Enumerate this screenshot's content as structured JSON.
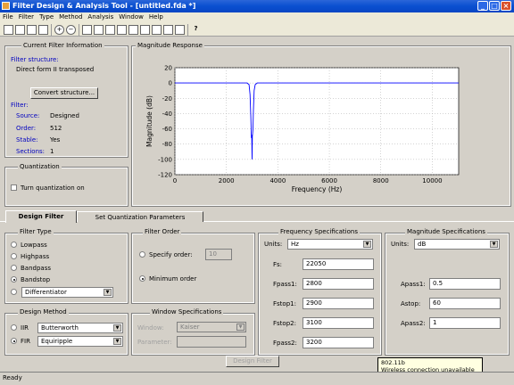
{
  "window": {
    "title": "Filter Design & Analysis Tool - [untitled.fda *]"
  },
  "menu": [
    "File",
    "Filter",
    "Type",
    "Method",
    "Analysis",
    "Window",
    "Help"
  ],
  "current_filter": {
    "title": "Current Filter Information",
    "structure_label": "Filter structure:",
    "structure_value": "Direct form II transposed",
    "convert_button": "Convert structure...",
    "filter_label": "Filter:",
    "source_label": "Source:",
    "source_value": "Designed",
    "order_label": "Order:",
    "order_value": "512",
    "stable_label": "Stable:",
    "stable_value": "Yes",
    "sections_label": "Sections:",
    "sections_value": "1"
  },
  "quantization": {
    "title": "Quantization",
    "checkbox_label": "Turn quantization on"
  },
  "plot_title": "Magnitude Response",
  "chart_data": {
    "type": "line",
    "title": "",
    "xlabel": "Frequency (Hz)",
    "ylabel": "Magnitude (dB)",
    "xlim": [
      0,
      11025
    ],
    "ylim": [
      -120,
      20
    ],
    "xticks": [
      0,
      2000,
      4000,
      6000,
      8000,
      10000
    ],
    "yticks": [
      20,
      0,
      -20,
      -40,
      -60,
      -80,
      -100,
      -120
    ],
    "grid": true,
    "series": [
      {
        "x": [
          0,
          2800,
          2880,
          2920,
          2950,
          2970,
          2985,
          3000,
          3010,
          3020,
          3035,
          3050,
          3080,
          3120,
          3200,
          11025
        ],
        "y": [
          0,
          0,
          -2,
          -15,
          -45,
          -72,
          -68,
          -100,
          -70,
          -66,
          -60,
          -35,
          -10,
          -2,
          0,
          0
        ],
        "color": "#0000ff"
      }
    ]
  },
  "tabs": {
    "design": "Design Filter",
    "quant": "Set Quantization Parameters"
  },
  "filter_type": {
    "title": "Filter Type",
    "lowpass": "Lowpass",
    "highpass": "Highpass",
    "bandpass": "Bandpass",
    "bandstop": "Bandstop",
    "differentiator": "Differentiator"
  },
  "design_method": {
    "title": "Design Method",
    "iir": "IIR",
    "iir_value": "Butterworth",
    "fir": "FIR",
    "fir_value": "Equiripple"
  },
  "filter_order": {
    "title": "Filter Order",
    "specify": "Specify order:",
    "specify_value": "10",
    "minimum": "Minimum order"
  },
  "window_specs": {
    "title": "Window Specifications",
    "window_label": "Window:",
    "window_value": "Kaiser",
    "param_label": "Parameter:"
  },
  "freq_specs": {
    "title": "Frequency Specifications",
    "units_label": "Units:",
    "units_value": "Hz",
    "fs_label": "Fs:",
    "fs": "22050",
    "fpass1_label": "Fpass1:",
    "fpass1": "2800",
    "fstop1_label": "Fstop1:",
    "fstop1": "2900",
    "fstop2_label": "Fstop2:",
    "fstop2": "3100",
    "fpass2_label": "Fpass2:",
    "fpass2": "3200"
  },
  "mag_specs": {
    "title": "Magnitude Specifications",
    "units_label": "Units:",
    "units_value": "dB",
    "apass1_label": "Apass1:",
    "apass1": "0.5",
    "astop_label": "Astop:",
    "astop": "60",
    "apass2_label": "Apass2:",
    "apass2": "1"
  },
  "design_button": "Design Filter",
  "tooltip": {
    "line1": "802.11b",
    "line2": "Wireless connection unavailable"
  },
  "status": "Ready"
}
